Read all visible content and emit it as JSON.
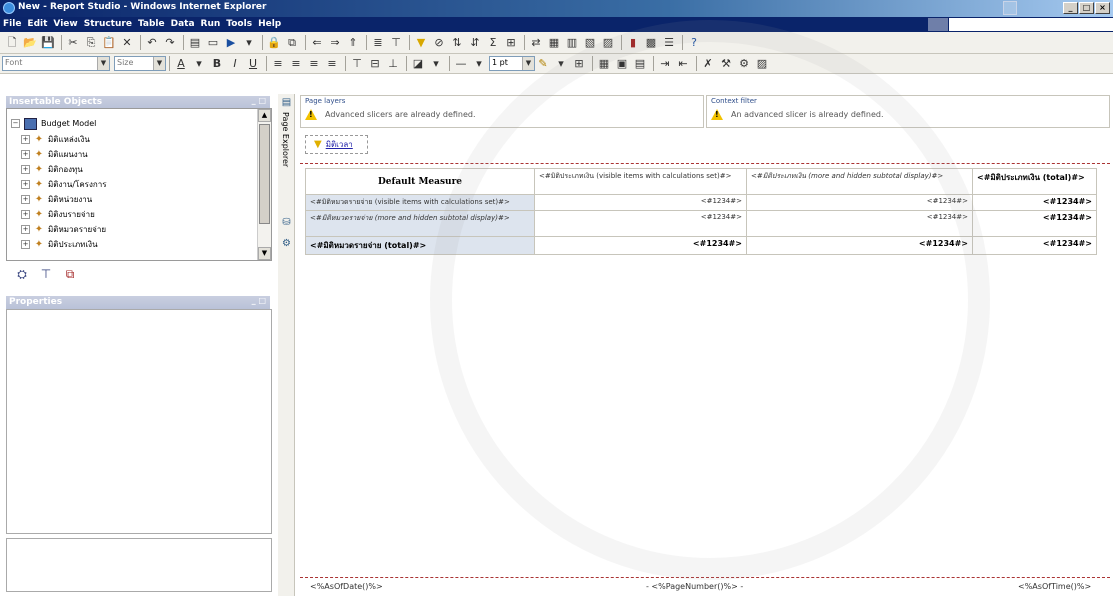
{
  "window": {
    "title": "New - Report Studio - Windows Internet Explorer",
    "controls": [
      "_",
      "□",
      "×"
    ]
  },
  "menu": [
    "File",
    "Edit",
    "View",
    "Structure",
    "Table",
    "Data",
    "Run",
    "Tools",
    "Help"
  ],
  "toolbar2": {
    "font_placeholder": "Font",
    "size_placeholder": "Size",
    "line_width": "1 pt"
  },
  "insertable": {
    "title": "Insertable Objects",
    "pane_btns": "_ □",
    "root": "Budget Model",
    "items": [
      "มิติแหล่งเงิน",
      "มิติแผนงาน",
      "มิติกองทุน",
      "มิติงาน/โครงการ",
      "มิติหน่วยงาน",
      "มิติงบรายจ่าย",
      "มิติหมวดรายจ่าย",
      "มิติประเภทเงิน"
    ]
  },
  "properties": {
    "title": "Properties",
    "pane_btns": "_ □"
  },
  "explorer": {
    "label": "Page Explorer"
  },
  "layers": {
    "title": "Page layers",
    "message": "Advanced slicers are already defined."
  },
  "context": {
    "title": "Context filter",
    "message": "An advanced slicer is already defined."
  },
  "slicer": {
    "label": "มิติเวลา"
  },
  "crosstab": {
    "corner": "Default Measure",
    "columns": [
      "<#มิติประเภทเงิน (visible items with calculations set)#>",
      "<#มิติประเภทเงิน (more and hidden subtotal display)#>",
      "<#มิติประเภทเงิน (total)#>"
    ],
    "rows": [
      {
        "label": "<#มิติหมวดรายจ่าย (visible items with calculations set)#>",
        "values": [
          "<#1234#>",
          "<#1234#>",
          "<#1234#>"
        ]
      },
      {
        "label": "<#มิติหมวดรายจ่าย (more and hidden subtotal display)#>",
        "values": [
          "<#1234#>",
          "<#1234#>",
          "<#1234#>"
        ]
      },
      {
        "label": "<#มิติหมวดรายจ่าย (total)#>",
        "values": [
          "<#1234#>",
          "<#1234#>",
          "<#1234#>"
        ]
      }
    ]
  },
  "footer": {
    "left": "<%AsOfDate()%>",
    "center": "- <%PageNumber()%> -",
    "right": "<%AsOfTime()%>"
  }
}
